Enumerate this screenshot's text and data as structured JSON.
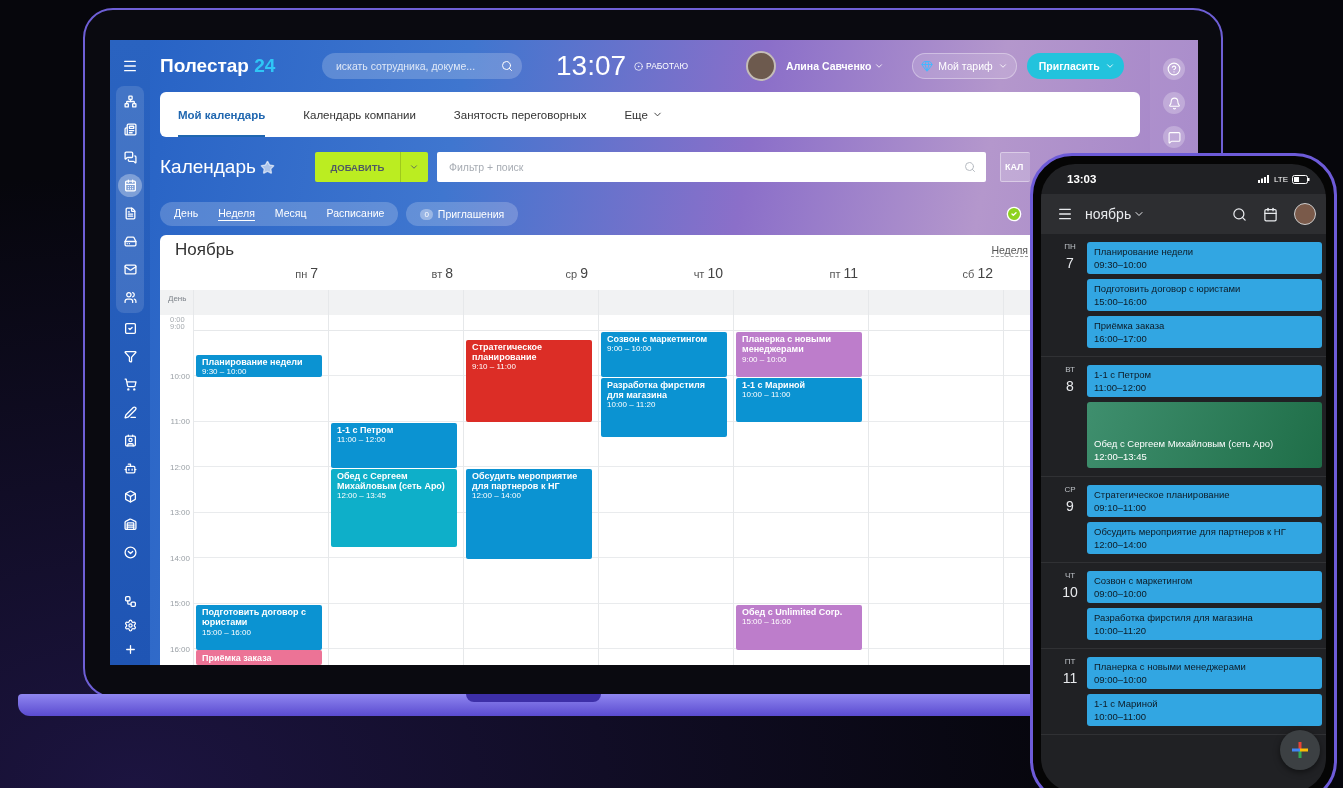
{
  "laptop": {
    "header": {
      "logo_name": "Полестар",
      "logo_number": "24",
      "search": {
        "placeholder": "искать сотрудника, докуме..."
      },
      "clock": "13:07",
      "work_status": "РАБОТАЮ",
      "user": "Алина Савченко",
      "plan_button": "Мой тариф",
      "invite_button": "Пригласить"
    },
    "sidebar": {
      "items": [
        {
          "kind": "network",
          "selected": false
        },
        {
          "kind": "feed",
          "selected": false
        },
        {
          "kind": "chat",
          "selected": false
        },
        {
          "kind": "calendar",
          "selected": true
        },
        {
          "kind": "document",
          "selected": false
        },
        {
          "kind": "drive",
          "selected": false
        },
        {
          "kind": "mail",
          "selected": false
        },
        {
          "kind": "users",
          "selected": false
        },
        {
          "kind": "tasks",
          "selected": false
        },
        {
          "kind": "funnel",
          "selected": false
        },
        {
          "kind": "cart",
          "selected": false
        },
        {
          "kind": "signature",
          "selected": false
        },
        {
          "kind": "contact",
          "selected": false
        },
        {
          "kind": "robot",
          "selected": false
        },
        {
          "kind": "box",
          "selected": false
        },
        {
          "kind": "warehouse",
          "selected": false
        },
        {
          "kind": "more",
          "selected": false
        }
      ],
      "bottom_items": [
        {
          "kind": "sitemap",
          "selected": false
        },
        {
          "kind": "settings",
          "selected": false
        },
        {
          "kind": "plus",
          "selected": false
        }
      ]
    },
    "tabs": [
      {
        "label": "Мой календарь",
        "selected": true,
        "kind": "plain"
      },
      {
        "label": "Календарь компании",
        "selected": false,
        "kind": "plain"
      },
      {
        "label": "Занятость переговорных",
        "selected": false,
        "kind": "plain"
      },
      {
        "label": "Еще",
        "selected": false,
        "kind": "more"
      }
    ],
    "toolbar": {
      "title": "Календарь",
      "add_button": "ДОБАВИТЬ",
      "filter": {
        "placeholder": "Фильтр + поиск"
      },
      "side_button": "КАЛ"
    },
    "views": [
      {
        "label": "День",
        "selected": false
      },
      {
        "label": "Неделя",
        "selected": true
      },
      {
        "label": "Месяц",
        "selected": false
      },
      {
        "label": "Расписание",
        "selected": false
      }
    ],
    "invitations": {
      "count": "0",
      "label": "Приглашения"
    },
    "calendar": {
      "month": "Ноябрь",
      "mode": "Неделя",
      "allday_label": "День",
      "collapsed_hours": [
        "0:00",
        "9:00"
      ],
      "hours": [
        "10:00",
        "11:00",
        "12:00",
        "13:00",
        "14:00",
        "15:00",
        "16:00"
      ],
      "days": [
        {
          "weekday": "пн",
          "number": "7",
          "events": [
            {
              "title": "Планирование недели",
              "time": "9:30 – 10:00",
              "color": "#0b93d2"
            },
            {
              "title": "Подготовить договор с юристами",
              "time": "15:00 – 16:00",
              "color": "#0b93d2"
            },
            {
              "title": "Приёмка заказа",
              "color": "#ec7396"
            }
          ]
        },
        {
          "weekday": "вт",
          "number": "8",
          "events": [
            {
              "title": "1-1 с Петром",
              "time": "11:00 – 12:00",
              "color": "#0b93d2"
            },
            {
              "title": "Обед с Сергеем Михайловым (сеть Аро)",
              "time": "12:00 – 13:45",
              "color": "#0eafc9"
            }
          ]
        },
        {
          "weekday": "ср",
          "number": "9",
          "events": [
            {
              "title": "Стратегическое планирование",
              "time": "9:10 – 11:00",
              "color": "#dc2d26"
            },
            {
              "title": "Обсудить мероприятие для партнеров к НГ",
              "time": "12:00 – 14:00",
              "color": "#0b93d2"
            }
          ]
        },
        {
          "weekday": "чт",
          "number": "10",
          "events": [
            {
              "title": "Созвон с маркетингом",
              "time": "9:00 – 10:00",
              "color": "#0b93d2"
            },
            {
              "title": "Разработка фирстиля для магазина",
              "time": "10:00 – 11:20",
              "color": "#0b93d2"
            }
          ]
        },
        {
          "weekday": "пт",
          "number": "11",
          "events": [
            {
              "title": "Планерка с новыми менеджерами",
              "time": "9:00 – 10:00",
              "color": "#bd7dcb"
            },
            {
              "title": "1-1 с Мариной",
              "time": "10:00 – 11:00",
              "color": "#0b93d2"
            },
            {
              "title": "Обед с Unlimited Corp.",
              "time": "15:00 – 16:00",
              "color": "#bd7dcb"
            }
          ]
        },
        {
          "weekday": "сб",
          "number": "12"
        }
      ]
    }
  },
  "phone": {
    "clock": "13:03",
    "network": "LTE",
    "month": "ноябрь",
    "days": [
      {
        "weekday": "ПН",
        "number": "7",
        "events": [
          {
            "title": "Планирование недели",
            "time": "09:30–10:00",
            "kind": "plain"
          },
          {
            "title": "Подготовить договор с юристами",
            "time": "15:00–16:00",
            "kind": "plain"
          },
          {
            "title": "Приёмка заказа",
            "time": "16:00–17:00",
            "kind": "plain"
          }
        ]
      },
      {
        "weekday": "ВТ",
        "number": "8",
        "events": [
          {
            "title": "1-1 с Петром",
            "time": "11:00–12:00",
            "kind": "plain"
          },
          {
            "title": "Обед с Сергеем Михайловым (сеть Аро)",
            "time": "12:00–13:45",
            "kind": "photo"
          }
        ]
      },
      {
        "weekday": "СР",
        "number": "9",
        "events": [
          {
            "title": "Стратегическое планирование",
            "time": "09:10–11:00",
            "kind": "plain"
          },
          {
            "title": "Обсудить мероприятие для партнеров к НГ",
            "time": "12:00–14:00",
            "kind": "plain"
          }
        ]
      },
      {
        "weekday": "ЧТ",
        "number": "10",
        "events": [
          {
            "title": "Созвон с маркетингом",
            "time": "09:00–10:00",
            "kind": "plain"
          },
          {
            "title": "Разработка фирстиля для магазина",
            "time": "10:00–11:20",
            "kind": "plain"
          }
        ]
      },
      {
        "weekday": "ПТ",
        "number": "11",
        "events": [
          {
            "title": "Планерка с новыми менеджерами",
            "time": "09:00–10:00",
            "kind": "plain"
          },
          {
            "title": "1-1 с Мариной",
            "time": "10:00–11:00",
            "kind": "plain"
          }
        ]
      }
    ]
  }
}
